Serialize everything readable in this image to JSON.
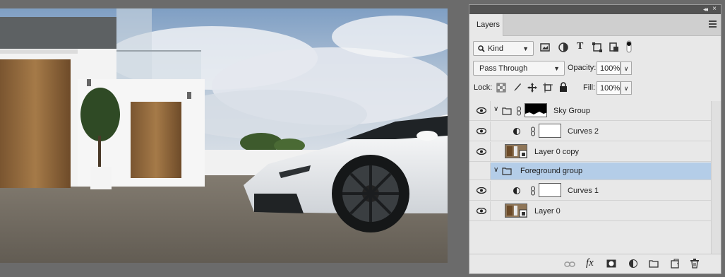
{
  "panel": {
    "tab_label": "Layers",
    "filter": {
      "value": "Kind"
    },
    "blend_mode": {
      "value": "Pass Through"
    },
    "opacity": {
      "label": "Opacity:",
      "value": "100%"
    },
    "lock": {
      "label": "Lock:"
    },
    "fill": {
      "label": "Fill:",
      "value": "100%"
    },
    "footer_fx_label": "fx"
  },
  "layers": [
    {
      "name": "Sky Group",
      "kind": "group",
      "expanded": true,
      "has_mask": true,
      "selected": false
    },
    {
      "name": "Curves 2",
      "kind": "adjustment",
      "selected": false
    },
    {
      "name": "Layer 0 copy",
      "kind": "smart-object",
      "selected": false
    },
    {
      "name": "Foreground group",
      "kind": "group",
      "expanded": true,
      "has_mask": false,
      "selected": true
    },
    {
      "name": "Curves 1",
      "kind": "adjustment",
      "selected": false
    },
    {
      "name": "Layer 0",
      "kind": "smart-object",
      "selected": false
    }
  ],
  "colors": {
    "selected_row": "#b4cde8",
    "panel_bg": "#e8e8e8",
    "workspace_bg": "#6b6b6b"
  }
}
